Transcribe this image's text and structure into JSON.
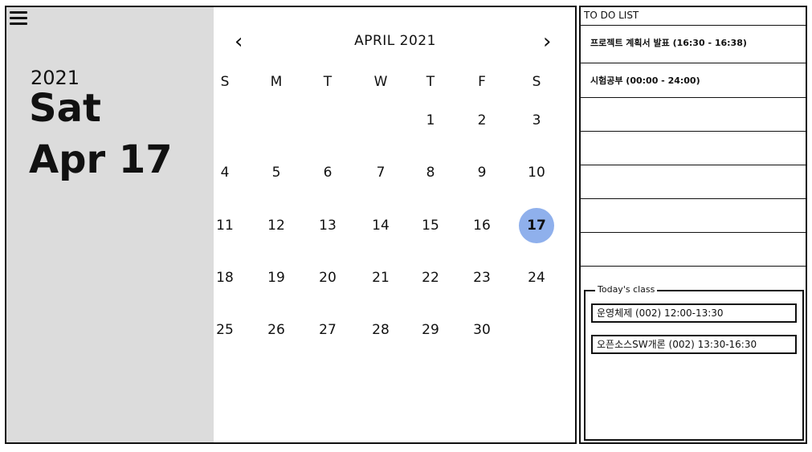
{
  "sidebar": {
    "menu_icon": "hamburger-icon",
    "year": "2021",
    "weekday": "Sat",
    "date": "Apr 17"
  },
  "calendar": {
    "prev_label": "‹",
    "next_label": "›",
    "month_title": "APRIL 2021",
    "weekdays": [
      "S",
      "M",
      "T",
      "W",
      "T",
      "F",
      "S"
    ],
    "weeks": [
      [
        "",
        "",
        "",
        "",
        "1",
        "2",
        "3"
      ],
      [
        "4",
        "5",
        "6",
        "7",
        "8",
        "9",
        "10"
      ],
      [
        "11",
        "12",
        "13",
        "14",
        "15",
        "16",
        "17"
      ],
      [
        "18",
        "19",
        "20",
        "21",
        "22",
        "23",
        "24"
      ],
      [
        "25",
        "26",
        "27",
        "28",
        "29",
        "30",
        ""
      ]
    ],
    "selected_day": "17",
    "selected_color": "#8fb0ec"
  },
  "todo": {
    "title": "TO DO LIST",
    "items": [
      "프로젝트 계획서 발표 (16:30 - 16:38)",
      "시험공부 (00:00 - 24:00)",
      "",
      "",
      "",
      "",
      ""
    ]
  },
  "today_class": {
    "legend": "Today's class",
    "items": [
      "운영체제 (002) 12:00-13:30",
      "오픈소스SW개론 (002) 13:30-16:30"
    ]
  }
}
